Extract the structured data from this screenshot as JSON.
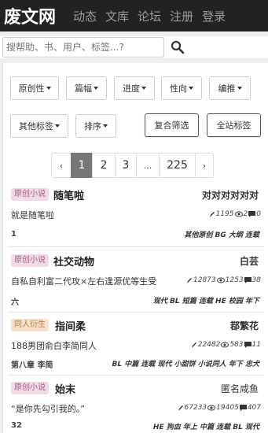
{
  "site": {
    "brand": "废文网",
    "nav": [
      "动态",
      "文库",
      "论坛",
      "注册",
      "登录"
    ]
  },
  "search": {
    "placeholder": "搜帮助、书、用户、标签...?"
  },
  "filters": {
    "row1": [
      "原创性",
      "篇幅",
      "进度",
      "性向",
      "编推"
    ],
    "row2": [
      "其他标签",
      "排序"
    ],
    "actions": [
      "复合筛选",
      "全站标签"
    ]
  },
  "pagination": {
    "prev": "‹",
    "pages": [
      "1",
      "2",
      "3",
      "...",
      "225"
    ],
    "next": "›",
    "current": "1"
  },
  "books": [
    {
      "category": "原创小说",
      "title": "随笔啦",
      "author": "对对对对对对",
      "desc": "就是随笔啦",
      "stats": {
        "words": "1195",
        "views": "2",
        "comments": "0"
      },
      "chapter": "1",
      "tags": "其他原创 BG 大纲 连载"
    },
    {
      "category": "原创小说",
      "title": "社交动物",
      "author": "白芸",
      "desc": "自私自利富二代攻×左右逢源优等生受",
      "stats": {
        "words": "12873",
        "views": "1253",
        "comments": "38"
      },
      "chapter": "六",
      "tags": "现代 BL 短篇 连载 HE 校园 年下"
    },
    {
      "category": "同人衍生",
      "title": "指间柔",
      "author": "鄀繁花",
      "desc": "188男团俞白李简同人",
      "stats": {
        "words": "22482",
        "views": "583",
        "comments": "11"
      },
      "chapter": "第八章 李简",
      "tags": "BL 中篇 连载 现代 小甜饼 小说同人 年下 忠犬"
    },
    {
      "category": "原创小说",
      "title": "始末",
      "author": "匿名咸鱼",
      "desc": "“是你先勾引我的。”",
      "stats": {
        "words": "67233",
        "views": "19405",
        "comments": "407"
      },
      "chapter": "32",
      "tags": "HE 狗血 年上 中篇 连载 BL 现代"
    }
  ]
}
